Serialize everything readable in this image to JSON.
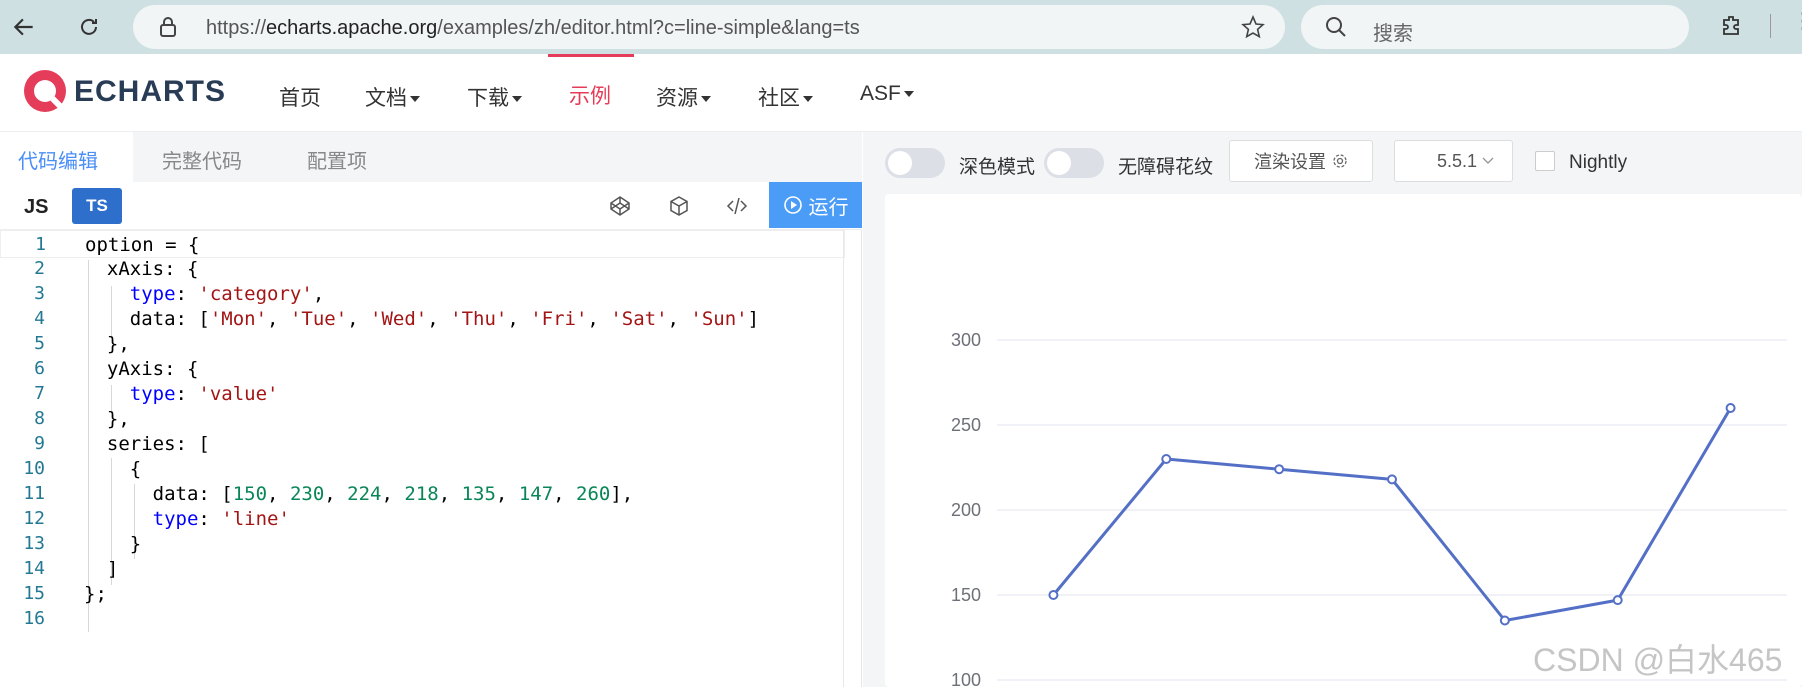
{
  "browser": {
    "url_scheme": "https://",
    "url_host": "echarts.apache.org",
    "url_path": "/examples/zh/editor.html?c=line-simple&lang=ts",
    "search_placeholder": "搜索"
  },
  "site": {
    "logo_text": "ECHARTS",
    "nav": [
      {
        "label": "首页",
        "dropdown": false
      },
      {
        "label": "文档",
        "dropdown": true
      },
      {
        "label": "下载",
        "dropdown": true
      },
      {
        "label": "示例",
        "dropdown": false,
        "active": true
      },
      {
        "label": "资源",
        "dropdown": true
      },
      {
        "label": "社区",
        "dropdown": true
      },
      {
        "label": "ASF",
        "dropdown": true
      }
    ],
    "accent_color": "#e43c59"
  },
  "editor": {
    "tabs": [
      "代码编辑",
      "完整代码",
      "配置项"
    ],
    "active_tab": "代码编辑",
    "lang_js": "JS",
    "lang_ts": "TS",
    "run_label": "运行",
    "code_lines": [
      "option = {",
      "  xAxis: {",
      "    type: 'category',",
      "    data: ['Mon', 'Tue', 'Wed', 'Thu', 'Fri', 'Sat', 'Sun']",
      "  },",
      "  yAxis: {",
      "    type: 'value'",
      "  },",
      "  series: [",
      "    {",
      "      data: [150, 230, 224, 218, 135, 147, 260],",
      "      type: 'line'",
      "    }",
      "  ]",
      "};",
      ""
    ]
  },
  "preview": {
    "dark_mode_label": "深色模式",
    "a11y_label": "无障碍花纹",
    "render_settings_label": "渲染设置",
    "version": "5.5.1",
    "nightly_label": "Nightly"
  },
  "watermark": "CSDN @白水465",
  "chart_data": {
    "type": "line",
    "categories": [
      "Mon",
      "Tue",
      "Wed",
      "Thu",
      "Fri",
      "Sat",
      "Sun"
    ],
    "values": [
      150,
      230,
      224,
      218,
      135,
      147,
      260
    ],
    "y_ticks_visible": [
      300,
      250,
      200,
      150,
      100
    ],
    "color": "#5470c6",
    "grid_color": "#e0e6f1"
  }
}
